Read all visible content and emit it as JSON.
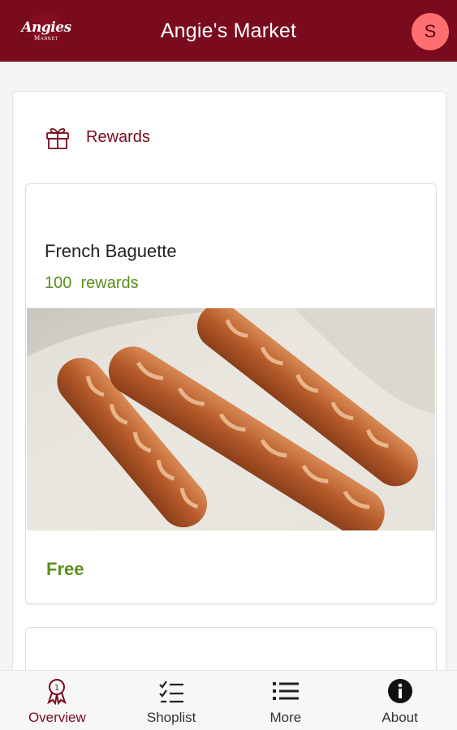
{
  "header": {
    "logo_script": "Angies",
    "logo_sub": "Market",
    "title": "Angie's Market",
    "avatar_initial": "S"
  },
  "rewards_section": {
    "label": "Rewards",
    "icon": "gift-icon"
  },
  "reward_item": {
    "name": "French Baguette",
    "points": "100  rewards",
    "image": "french-baguettes-photo",
    "price": "Free"
  },
  "bottom_nav": [
    {
      "label": "Overview",
      "icon": "ribbon-badge-icon",
      "active": true
    },
    {
      "label": "Shoplist",
      "icon": "checklist-icon",
      "active": false
    },
    {
      "label": "More",
      "icon": "list-icon",
      "active": false
    },
    {
      "label": "About",
      "icon": "info-icon",
      "active": false
    }
  ],
  "colors": {
    "brand": "#7a0b1f",
    "accent_green": "#5a8f1c",
    "avatar_bg": "#ff6f71"
  }
}
